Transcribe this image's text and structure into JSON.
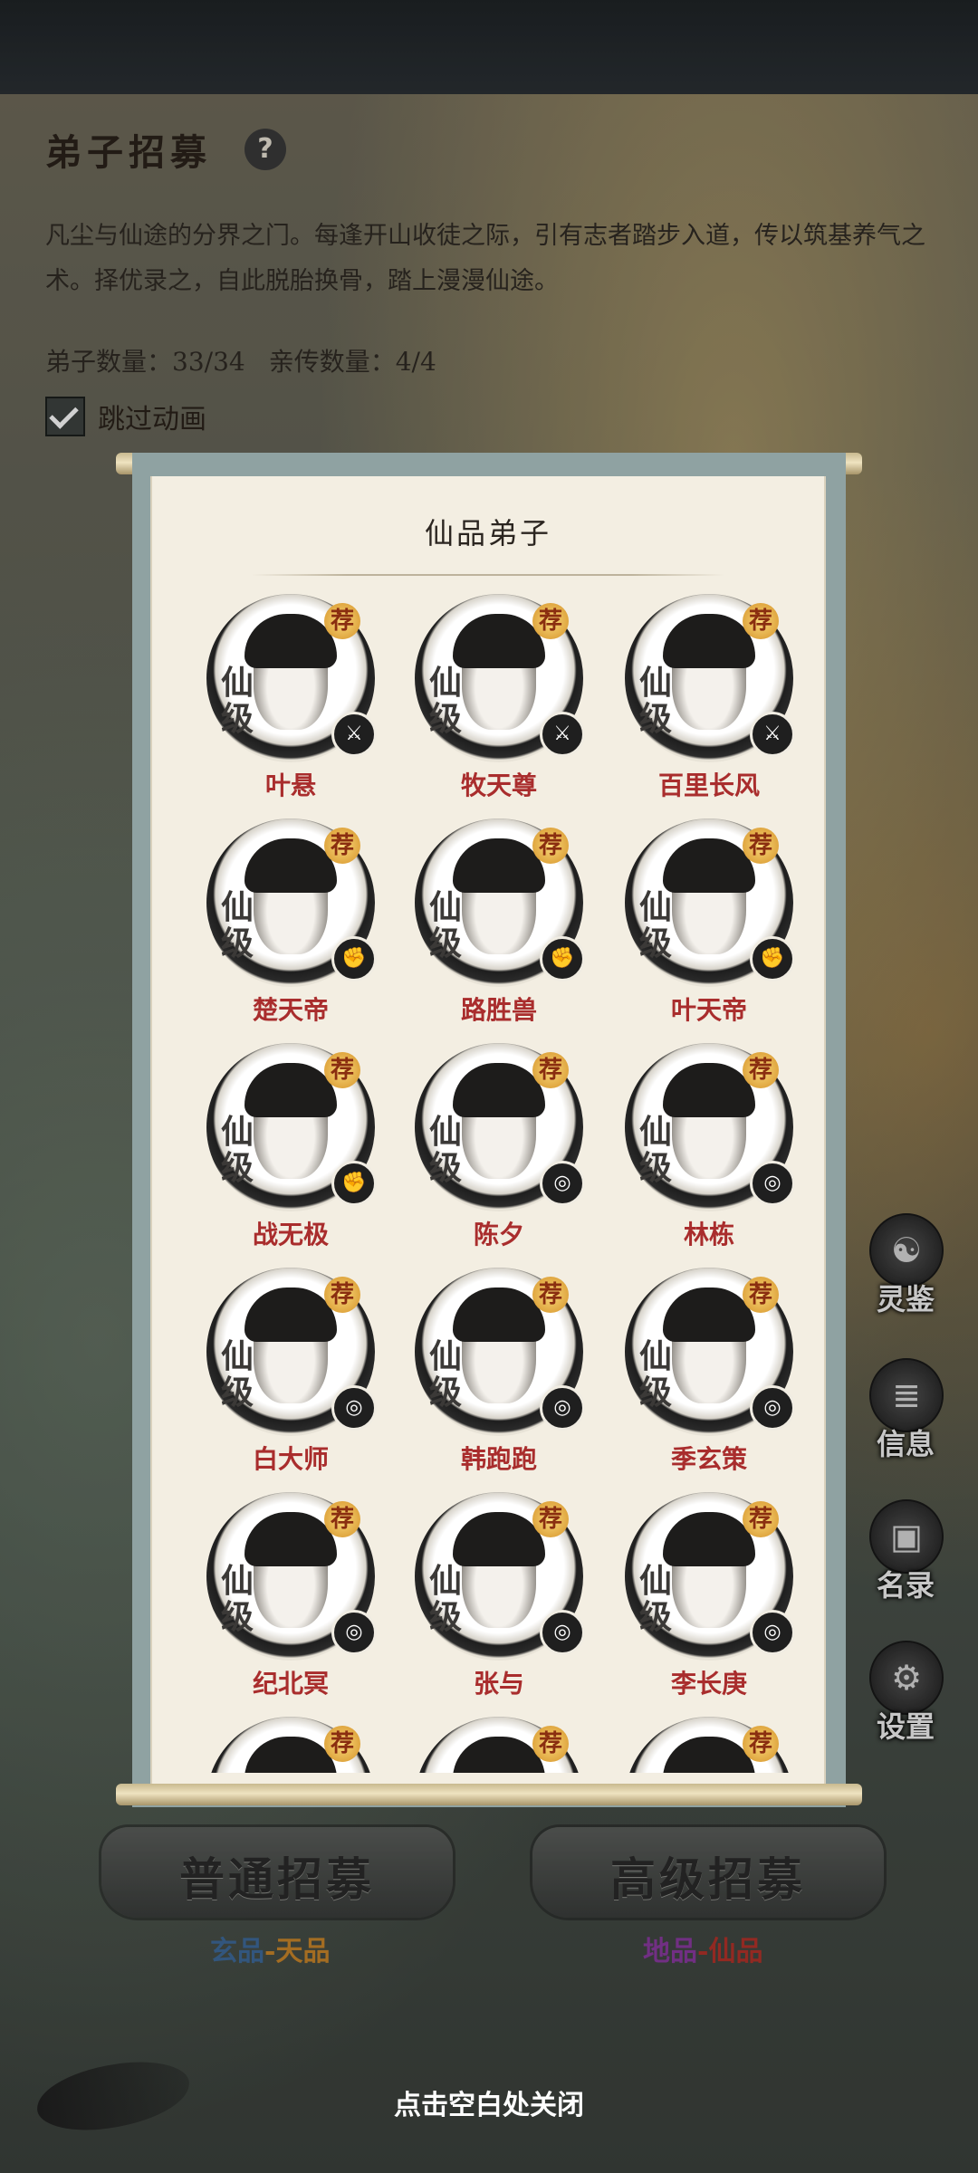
{
  "header": {
    "title": "弟子招募",
    "help_icon": "question-icon",
    "description": "凡尘与仙途的分界之门。每逢开山收徒之际，引有志者踏步入道，传以筑基养气之术。择优录之，自此脱胎换骨，踏上漫漫仙途。",
    "disciple_count": "弟子数量：33/34",
    "personal_count": "亲传数量：4/4",
    "skip_animation_label": "跳过动画",
    "skip_animation_checked": true
  },
  "scroll": {
    "title": "仙品弟子",
    "grade_char_1": "仙",
    "grade_char_2": "级",
    "recommend_char": "荐",
    "disciples": [
      {
        "name": "叶悬",
        "badge_icon": "sword-icon"
      },
      {
        "name": "牧天尊",
        "badge_icon": "sword-icon"
      },
      {
        "name": "百里长风",
        "badge_icon": "sword-icon"
      },
      {
        "name": "楚天帝",
        "badge_icon": "fist-icon"
      },
      {
        "name": "路胜兽",
        "badge_icon": "fist-icon"
      },
      {
        "name": "叶天帝",
        "badge_icon": "fist-icon"
      },
      {
        "name": "战无极",
        "badge_icon": "fist-icon"
      },
      {
        "name": "陈夕",
        "badge_icon": "spiral-icon"
      },
      {
        "name": "林栋",
        "badge_icon": "spiral-icon"
      },
      {
        "name": "白大师",
        "badge_icon": "spiral-icon"
      },
      {
        "name": "韩跑跑",
        "badge_icon": "spiral-icon"
      },
      {
        "name": "季玄策",
        "badge_icon": "spiral-icon"
      },
      {
        "name": "纪北冥",
        "badge_icon": "spiral-icon"
      },
      {
        "name": "张与",
        "badge_icon": "spiral-icon"
      },
      {
        "name": "李长庚",
        "badge_icon": "spiral-icon"
      },
      {
        "name": "",
        "badge_icon": "spiral-icon"
      },
      {
        "name": "",
        "badge_icon": "spiral-icon"
      },
      {
        "name": "",
        "badge_icon": "spiral-icon"
      }
    ]
  },
  "side_menu": [
    {
      "label": "灵鉴",
      "icon": "yinyang-icon"
    },
    {
      "label": "信息",
      "icon": "scroll-icon"
    },
    {
      "label": "名录",
      "icon": "portrait-icon"
    },
    {
      "label": "设置",
      "icon": "gear-icon"
    }
  ],
  "recruit": {
    "normal_label": "普通招募",
    "normal_range_low": "玄品",
    "normal_range_sep": "-",
    "normal_range_high": "天品",
    "advanced_label": "高级招募",
    "advanced_range_low": "地品",
    "advanced_range_sep": "-",
    "advanced_range_high": "仙品"
  },
  "close_hint": "点击空白处关闭",
  "colors": {
    "name_red": "#a92d2d",
    "xuan_blue": "#3e6a9a",
    "tian_orange": "#c8862a",
    "di_purple": "#8a3aa0",
    "xian_red": "#b3322a"
  }
}
